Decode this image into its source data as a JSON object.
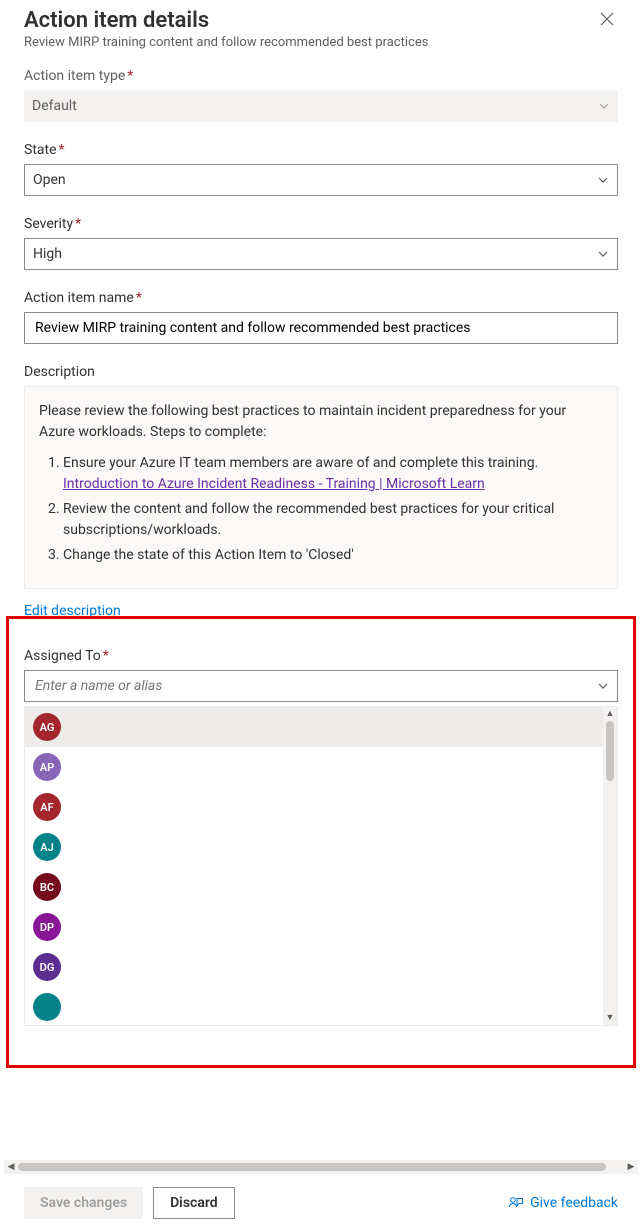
{
  "header": {
    "title": "Action item details",
    "subtitle": "Review MIRP training content and follow recommended best practices"
  },
  "fields": {
    "type_label": "Action item type",
    "type_value": "Default",
    "state_label": "State",
    "state_value": "Open",
    "severity_label": "Severity",
    "severity_value": "High",
    "name_label": "Action item name",
    "name_value": "Review MIRP training content and follow recommended best practices",
    "description_label": "Description",
    "description_intro": "Please review the following best practices to maintain incident preparedness for your Azure workloads. Steps to complete:",
    "description_steps": {
      "s1": "Ensure your Azure IT team members are aware of and complete this training.",
      "s1_link": "Introduction to Azure Incident Readiness - Training | Microsoft Learn",
      "s2": "Review the content and follow the recommended best practices for your critical subscriptions/workloads.",
      "s3": "Change the state of this Action Item to 'Closed'"
    },
    "edit_description": "Edit description",
    "assigned_label": "Assigned To",
    "assigned_placeholder": "Enter a name or alias"
  },
  "people": [
    {
      "initials": "AG",
      "color": "#a4262c"
    },
    {
      "initials": "AP",
      "color": "#8764b8"
    },
    {
      "initials": "AF",
      "color": "#a4262c"
    },
    {
      "initials": "AJ",
      "color": "#038387"
    },
    {
      "initials": "BC",
      "color": "#750b1c"
    },
    {
      "initials": "DP",
      "color": "#881798"
    },
    {
      "initials": "DG",
      "color": "#5c2e91"
    },
    {
      "initials": "",
      "color": "#038387"
    }
  ],
  "footer": {
    "save": "Save changes",
    "discard": "Discard",
    "feedback": "Give feedback"
  },
  "required_marker": "*"
}
